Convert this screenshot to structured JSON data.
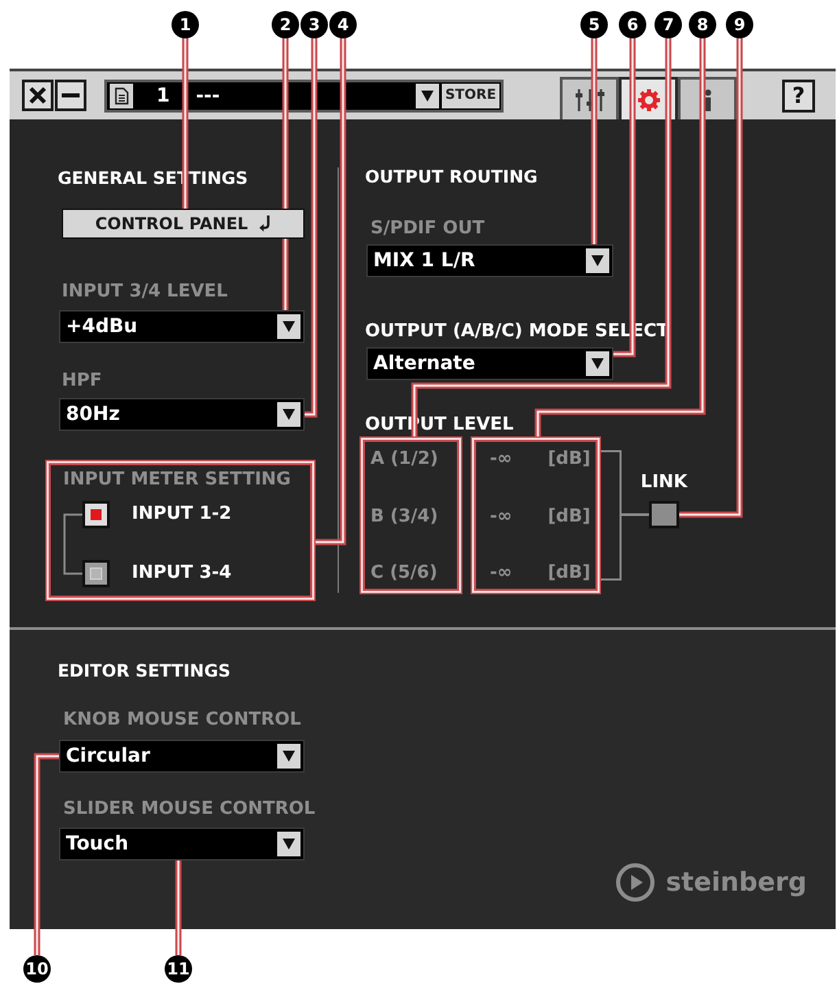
{
  "callouts": [
    {
      "number": "1"
    },
    {
      "number": "2"
    },
    {
      "number": "3"
    },
    {
      "number": "4"
    },
    {
      "number": "5"
    },
    {
      "number": "6"
    },
    {
      "number": "7"
    },
    {
      "number": "8"
    },
    {
      "number": "9"
    },
    {
      "number": "10"
    },
    {
      "number": "11"
    }
  ],
  "toolbar": {
    "preset_number": "1",
    "preset_name": "---",
    "store_button": "STORE",
    "tabs": [
      {
        "kind": "mixer",
        "selected": false
      },
      {
        "kind": "settings",
        "selected": true
      },
      {
        "kind": "info",
        "selected": false
      }
    ],
    "help_button": "?"
  },
  "general_settings": {
    "title": "GENERAL SETTINGS",
    "control_panel_button": "CONTROL PANEL",
    "input_level": {
      "label": "INPUT 3/4 LEVEL",
      "value": "+4dBu"
    },
    "hpf": {
      "label": "HPF",
      "value": "80Hz"
    },
    "input_meter": {
      "label": "INPUT METER SETTING",
      "options": [
        {
          "label": "INPUT 1-2",
          "selected": true
        },
        {
          "label": "INPUT 3-4",
          "selected": false
        }
      ]
    }
  },
  "output_routing": {
    "title": "OUTPUT ROUTING",
    "spdif_out": {
      "label": "S/PDIF OUT",
      "value": "MIX 1 L/R"
    },
    "mode_select": {
      "label": "OUTPUT (A/B/C) MODE SELECT",
      "value": "Alternate"
    },
    "output_level": {
      "label": "OUTPUT LEVEL",
      "channels": [
        {
          "name": "A (1/2)",
          "value": "-∞",
          "unit": "[dB]"
        },
        {
          "name": "B (3/4)",
          "value": "-∞",
          "unit": "[dB]"
        },
        {
          "name": "C (5/6)",
          "value": "-∞",
          "unit": "[dB]"
        }
      ]
    },
    "link": {
      "label": "LINK",
      "on": false
    }
  },
  "editor_settings": {
    "title": "EDITOR SETTINGS",
    "knob_mouse_control": {
      "label": "KNOB MOUSE CONTROL",
      "value": "Circular"
    },
    "slider_mouse_control": {
      "label": "SLIDER MOUSE CONTROL",
      "value": "Touch"
    }
  },
  "logo": {
    "text": "steinberg"
  }
}
